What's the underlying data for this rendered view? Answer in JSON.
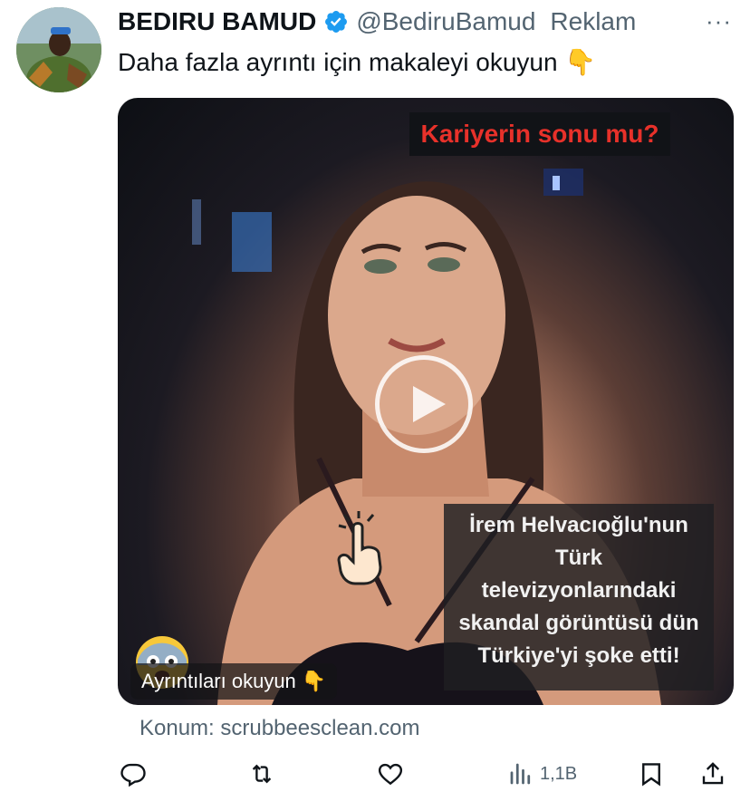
{
  "tweet": {
    "author_name": "BEDIRU BAMUD",
    "handle": "@BediruBamud",
    "ad_label": "Reklam",
    "more_label": "···",
    "text": "Daha fazla ayrıntı için makaleyi okuyun",
    "text_emoji": "👇"
  },
  "media": {
    "top_caption": "Kariyerin sonu mu?",
    "overlay_lines": [
      "İrem Helvacıoğlu'nun",
      "Türk",
      "televizyonlarındaki",
      "skandal görüntüsü dün",
      "Türkiye'yi şoke etti!"
    ],
    "cta_label": "Ayrıntıları okuyun",
    "cta_emoji": "👇"
  },
  "location": {
    "text": "Konum: scrubbeesclean.com"
  },
  "actions": {
    "views_count": "1,1B"
  },
  "colors": {
    "verified": "#1d9bf0",
    "caption_red": "#e8312a",
    "secondary_text": "#536471"
  }
}
